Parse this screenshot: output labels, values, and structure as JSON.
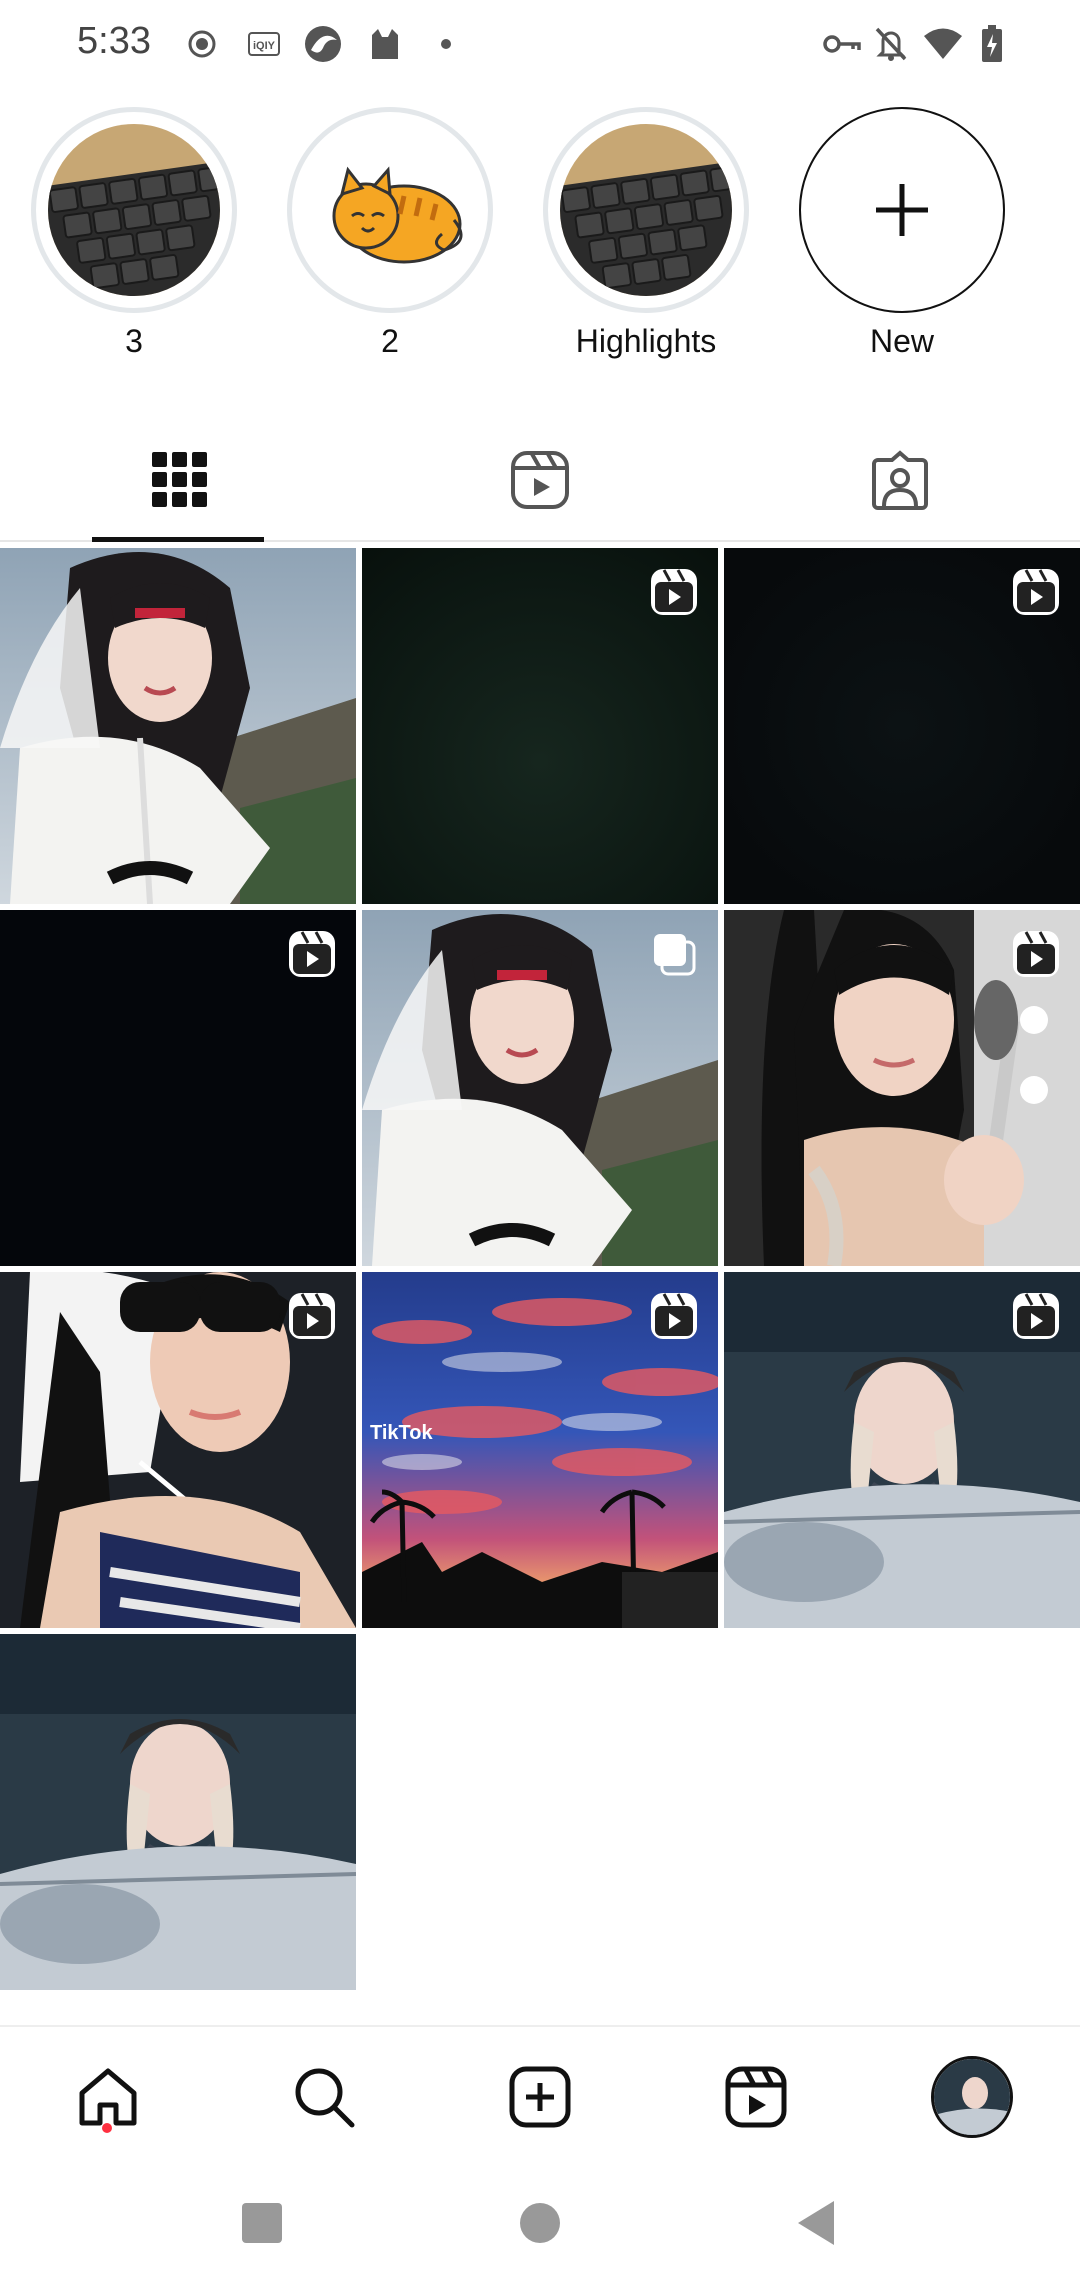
{
  "status_bar": {
    "time": "5:33",
    "left_icons": [
      "record-icon",
      "iqiyi-icon",
      "browser-icon",
      "cat-app-icon",
      "dot-icon"
    ],
    "right_icons": [
      "vpn-key-icon",
      "bell-off-icon",
      "wifi-icon",
      "battery-charging-icon"
    ]
  },
  "highlights": [
    {
      "label": "3",
      "thumb": "keyboard"
    },
    {
      "label": "2",
      "thumb": "cat"
    },
    {
      "label": "Highlights",
      "thumb": "keyboard"
    },
    {
      "label": "New",
      "thumb": "plus"
    }
  ],
  "tabs": [
    {
      "name": "grid",
      "icon": "grid-icon",
      "selected": true
    },
    {
      "name": "reels",
      "icon": "reels-icon",
      "selected": false
    },
    {
      "name": "tagged",
      "icon": "tagged-icon",
      "selected": false
    }
  ],
  "grid": [
    {
      "kind": "girl-fur",
      "badge": null
    },
    {
      "kind": "dark",
      "badge": "reel"
    },
    {
      "kind": "dark",
      "badge": "reel"
    },
    {
      "kind": "black",
      "badge": "reel"
    },
    {
      "kind": "girl-fur",
      "badge": "carousel"
    },
    {
      "kind": "girl-brush",
      "badge": "reel"
    },
    {
      "kind": "girl-sunglasses",
      "badge": "reel"
    },
    {
      "kind": "sunset",
      "badge": "reel",
      "overlay_text": "TikTok"
    },
    {
      "kind": "girl-car",
      "badge": "reel"
    },
    {
      "kind": "girl-car",
      "badge": null
    }
  ],
  "bottom_nav": [
    "home-icon",
    "search-icon",
    "create-icon",
    "reels-icon",
    "profile-avatar"
  ],
  "system_nav": [
    "recents-button",
    "home-button",
    "back-button"
  ],
  "colors": {
    "notification_dot": "#ff3040",
    "ring": "#e3e7ea",
    "text": "#111111"
  }
}
